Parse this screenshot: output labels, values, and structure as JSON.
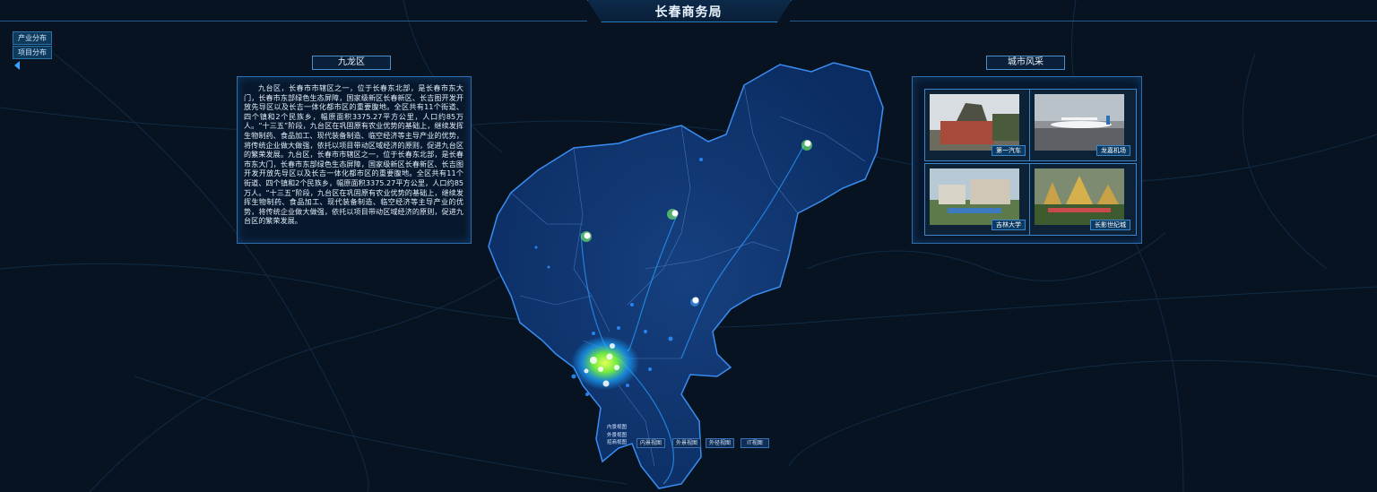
{
  "header": {
    "title": "长春商务局"
  },
  "left_menu": {
    "items": [
      "产业分布",
      "项目分布"
    ]
  },
  "district_panel": {
    "title": "九龙区",
    "text": "九台区，长春市市辖区之一，位于长春东北部，是长春市东大门，长春市东部绿色生态屏障，国家级新区长春新区、长吉图开发开放先导区以及长吉一体化都市区的重要腹地。全区共有11个街道、四个镇和2个民族乡，幅原面积3375.27平方公里，人口约85万人。“十三五”阶段，九台区在巩固原有农业优势的基础上，继续发挥生物制药、食品加工、现代装备制造、临空经济等主导产业的优势，将传统企业做大做强，依托以项目带动区域经济的原则，促进九台区的繁荣发展。九台区，长春市市辖区之一，位于长春东北部，是长春市东大门，长春市东部绿色生态屏障，国家级新区长春新区、长吉图开发开放先导区以及长吉一体化都市区的重要腹地。全区共有11个街道、四个镇和2个民族乡，幅原面积3375.27平方公里，人口约85万人。“十三五”阶段，九台区在巩固原有农业优势的基础上，继续发挥生物制药、食品加工、现代装备制造、临空经济等主导产业的优势，将传统企业做大做强，依托以项目带动区域经济的原则，促进九台区的繁荣发展。"
  },
  "city_panel": {
    "title": "城市风采",
    "photos": [
      {
        "caption": "第一汽车",
        "icon": "monument-photo"
      },
      {
        "caption": "龙嘉机场",
        "icon": "airport-photo"
      },
      {
        "caption": "吉林大学",
        "icon": "university-photo"
      },
      {
        "caption": "长影世纪城",
        "icon": "theme-park-photo"
      }
    ]
  },
  "map_legend": {
    "vertical": [
      "内景视图",
      "外景视图",
      "招商视图"
    ],
    "buttons": [
      "内景视图",
      "外景视图",
      "外径视图",
      "IT视图"
    ]
  },
  "colors": {
    "background": "#071321",
    "map_fill": "#0c2d66",
    "accent": "#2c6fb0",
    "heat": "#b8ff3a"
  }
}
